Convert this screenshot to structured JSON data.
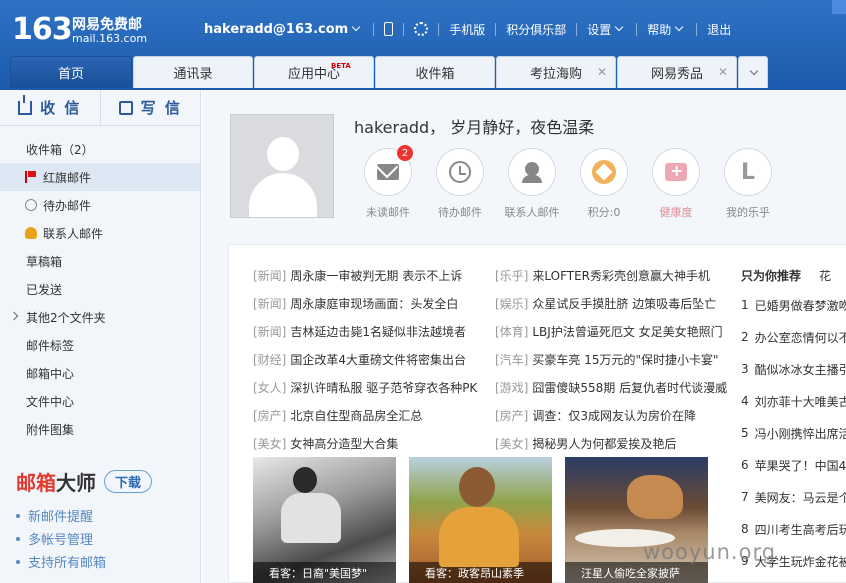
{
  "brand": {
    "logo_number": "163",
    "logo_line1": "网易免费邮",
    "logo_line2": "mail.163.com"
  },
  "user_nav": {
    "account": "hakeradd@163.com",
    "links": [
      "手机版",
      "积分俱乐部",
      "设置",
      "帮助",
      "退出"
    ]
  },
  "tabs": [
    {
      "label": "首页",
      "active": true
    },
    {
      "label": "通讯录"
    },
    {
      "label": "应用中心",
      "badge": "BETA"
    },
    {
      "label": "收件箱"
    },
    {
      "label": "考拉海购",
      "closable": true
    },
    {
      "label": "网易秀品",
      "closable": true
    }
  ],
  "compose": {
    "receive": "收 信",
    "write": "写 信"
  },
  "folders": [
    {
      "label": "收件箱（2）"
    },
    {
      "label": "红旗邮件",
      "icon": "flag-icon"
    },
    {
      "label": "待办邮件",
      "icon": "clock-icon"
    },
    {
      "label": "联系人邮件",
      "icon": "contact-icon"
    },
    {
      "label": "草稿箱"
    },
    {
      "label": "已发送"
    },
    {
      "label": "其他2个文件夹",
      "expandable": true
    },
    {
      "label": "邮件标签"
    },
    {
      "label": "邮箱中心"
    },
    {
      "label": "文件中心"
    },
    {
      "label": "附件图集"
    }
  ],
  "promo": {
    "title_red": "邮箱",
    "title_black": "大师",
    "download": "下载",
    "items": [
      "新邮件提醒",
      "多帐号管理",
      "支持所有邮箱"
    ]
  },
  "profile": {
    "greeting": "hakeradd， 岁月静好，夜色温柔",
    "quick": [
      {
        "label": "未读邮件",
        "icon": "envelope-icon",
        "badge": "2"
      },
      {
        "label": "待办邮件",
        "icon": "clock-icon"
      },
      {
        "label": "联系人邮件",
        "icon": "contact-star-icon"
      },
      {
        "label": "积分:0",
        "icon": "points-icon"
      },
      {
        "label": "健康度",
        "icon": "health-kit-icon"
      },
      {
        "label": "我的乐乎",
        "icon": "lofter-l-icon",
        "letter": "L"
      }
    ]
  },
  "news_left": [
    {
      "cat": "[新闻]",
      "title": "周永康一审被判无期 表示不上诉"
    },
    {
      "cat": "[新闻]",
      "title": "周永康庭审现场画面：头发全白"
    },
    {
      "cat": "[新闻]",
      "title": "吉林延边击毙1名疑似非法越境者"
    },
    {
      "cat": "[财经]",
      "title": "国企改革4大重磅文件将密集出台"
    },
    {
      "cat": "[女人]",
      "title": "深扒许晴私服 驱子范爷穿衣各种PK"
    },
    {
      "cat": "[房产]",
      "title": "北京自住型商品房全汇总"
    },
    {
      "cat": "[美女]",
      "title": "女神高分造型大合集"
    }
  ],
  "news_right": [
    {
      "cat": "[乐乎]",
      "title": "来LOFTER秀彩壳创意赢大神手机"
    },
    {
      "cat": "[娱乐]",
      "title": "众星试反手摸肚脐 边策吸毒后坠亡"
    },
    {
      "cat": "[体育]",
      "title": "LBJ护法曾逼死厄文 女足美女艳照门"
    },
    {
      "cat": "[汽车]",
      "title": "买豪车亮 15万元的\"保时捷小卡宴\""
    },
    {
      "cat": "[游戏]",
      "title": "囧雷傻缺558期 后复仇者时代谈漫威"
    },
    {
      "cat": "[房产]",
      "title": "调查：仅3成网友认为房价在降"
    },
    {
      "cat": "[美女]",
      "title": "揭秘男人为何都爱挨及艳后"
    }
  ],
  "ranking": {
    "header": "只为你推荐",
    "more": "花",
    "items": [
      {
        "n": "1",
        "t": "已婚男做春梦激吻"
      },
      {
        "n": "2",
        "t": "办公室恋情何以不"
      },
      {
        "n": "3",
        "t": "酷似冰冰女主播引"
      },
      {
        "n": "4",
        "t": "刘亦菲十大唯美古"
      },
      {
        "n": "5",
        "t": "冯小刚携悴出席活"
      },
      {
        "n": "6",
        "t": "苹果哭了！中国4"
      },
      {
        "n": "7",
        "t": "美网友：马云是个"
      },
      {
        "n": "8",
        "t": "四川考生高考后玩"
      },
      {
        "n": "9",
        "t": "大学生玩炸金花被"
      }
    ]
  },
  "pictures": [
    {
      "caption": "看客：日裔\"美国梦\""
    },
    {
      "caption": "看客：政客昂山素季"
    },
    {
      "caption": "汪星人偷吃全家披萨"
    }
  ],
  "watermark": "wooyun.org"
}
